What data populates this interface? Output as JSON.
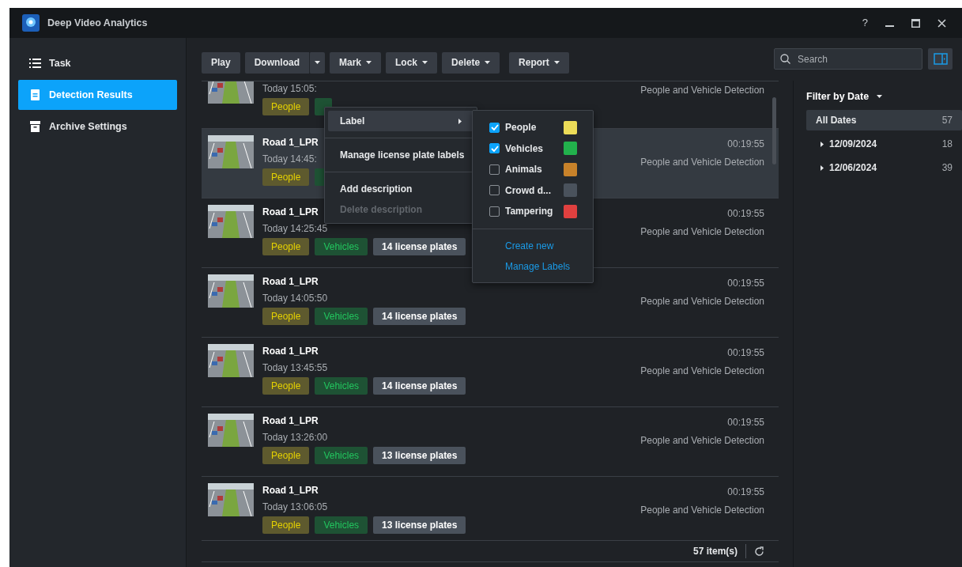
{
  "window": {
    "title": "Deep Video Analytics",
    "help": "?"
  },
  "sidebar": {
    "items": [
      {
        "label": "Task",
        "selected": false
      },
      {
        "label": "Detection Results",
        "selected": true
      },
      {
        "label": "Archive Settings",
        "selected": false
      }
    ]
  },
  "toolbar": {
    "buttons": [
      {
        "label": "Play",
        "kind": "plain"
      },
      {
        "label": "Download",
        "kind": "split"
      },
      {
        "label": "Mark",
        "kind": "dropdown"
      },
      {
        "label": "Lock",
        "kind": "dropdown"
      },
      {
        "label": "Delete",
        "kind": "dropdown"
      },
      {
        "label": "Report",
        "kind": "dropdown"
      }
    ]
  },
  "search": {
    "placeholder": "Search"
  },
  "results": {
    "rows": [
      {
        "time": "Today 15:05:",
        "type": "People and Vehicle Detection",
        "selected": false,
        "tags": [
          {
            "kind": "people",
            "text": "People"
          },
          {
            "kind": "vehicles"
          }
        ]
      },
      {
        "title": "Road 1_LPR",
        "time": "Today 14:45:",
        "duration": "00:19:55",
        "type": "People and Vehicle Detection",
        "selected": true,
        "tags": [
          {
            "kind": "people",
            "text": "People"
          },
          {
            "kind": "vehicles"
          }
        ]
      },
      {
        "title": "Road 1_LPR",
        "time": "Today 14:25:45",
        "duration": "00:19:55",
        "type": "People and Vehicle Detection",
        "selected": false,
        "tags": [
          {
            "kind": "people",
            "text": "People"
          },
          {
            "kind": "vehicles",
            "text": "Vehicles"
          },
          {
            "kind": "plates",
            "text": "14 license plates"
          }
        ]
      },
      {
        "title": "Road 1_LPR",
        "time": "Today 14:05:50",
        "duration": "00:19:55",
        "type": "People and Vehicle Detection",
        "selected": false,
        "tags": [
          {
            "kind": "people",
            "text": "People"
          },
          {
            "kind": "vehicles",
            "text": "Vehicles"
          },
          {
            "kind": "plates",
            "text": "14 license plates"
          }
        ]
      },
      {
        "title": "Road 1_LPR",
        "time": "Today 13:45:55",
        "duration": "00:19:55",
        "type": "People and Vehicle Detection",
        "selected": false,
        "tags": [
          {
            "kind": "people",
            "text": "People"
          },
          {
            "kind": "vehicles",
            "text": "Vehicles"
          },
          {
            "kind": "plates",
            "text": "14 license plates"
          }
        ]
      },
      {
        "title": "Road 1_LPR",
        "time": "Today 13:26:00",
        "duration": "00:19:55",
        "type": "People and Vehicle Detection",
        "selected": false,
        "tags": [
          {
            "kind": "people",
            "text": "People"
          },
          {
            "kind": "vehicles",
            "text": "Vehicles"
          },
          {
            "kind": "plates",
            "text": "13 license plates"
          }
        ]
      },
      {
        "title": "Road 1_LPR",
        "time": "Today 13:06:05",
        "duration": "00:19:55",
        "type": "People and Vehicle Detection",
        "selected": false,
        "tags": [
          {
            "kind": "people",
            "text": "People"
          },
          {
            "kind": "vehicles",
            "text": "Vehicles"
          },
          {
            "kind": "plates",
            "text": "13 license plates"
          }
        ]
      }
    ],
    "footer": {
      "count": "57 item(s)"
    }
  },
  "mark_menu": {
    "items": [
      {
        "kind": "submenu",
        "label": "Label",
        "selected": true,
        "disabled": false
      },
      {
        "kind": "divider"
      },
      {
        "kind": "item",
        "label": "Manage license plate labels",
        "selected": false,
        "disabled": false
      },
      {
        "kind": "divider"
      },
      {
        "kind": "item",
        "label": "Add description",
        "selected": false,
        "disabled": false
      },
      {
        "kind": "item",
        "label": "Delete description",
        "selected": false,
        "disabled": true
      }
    ]
  },
  "label_menu": {
    "labels": [
      {
        "name": "People",
        "checked": true,
        "color": "#ecdc58"
      },
      {
        "name": "Vehicles",
        "checked": true,
        "color": "#22b14c"
      },
      {
        "name": "Animals",
        "checked": false,
        "color": "#c8822a"
      },
      {
        "name": "Crowd d...",
        "checked": false,
        "color": "#4a525c"
      },
      {
        "name": "Tampering",
        "checked": false,
        "color": "#e0403f"
      }
    ],
    "links": [
      "Create new",
      "Manage Labels"
    ]
  },
  "filter": {
    "title": "Filter by Date",
    "dates": [
      {
        "label": "All Dates",
        "count": "57",
        "selected": true,
        "children": [
          {
            "label": "12/09/2024",
            "count": "18",
            "selected": false,
            "expanded": false
          },
          {
            "label": "12/06/2024",
            "count": "39",
            "selected": false,
            "expanded": false
          }
        ]
      }
    ]
  }
}
